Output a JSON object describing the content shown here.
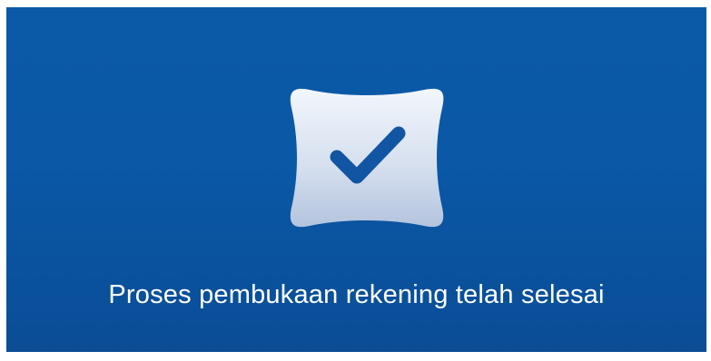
{
  "colors": {
    "background": "#0a57a4",
    "badge_light": "#eef3fb",
    "badge_dark": "#b7c7e0",
    "checkmark": "#1256a3",
    "text": "#ffffff"
  },
  "badge": {
    "icon": "check-icon"
  },
  "message": "Proses pembukaan rekening telah selesai"
}
